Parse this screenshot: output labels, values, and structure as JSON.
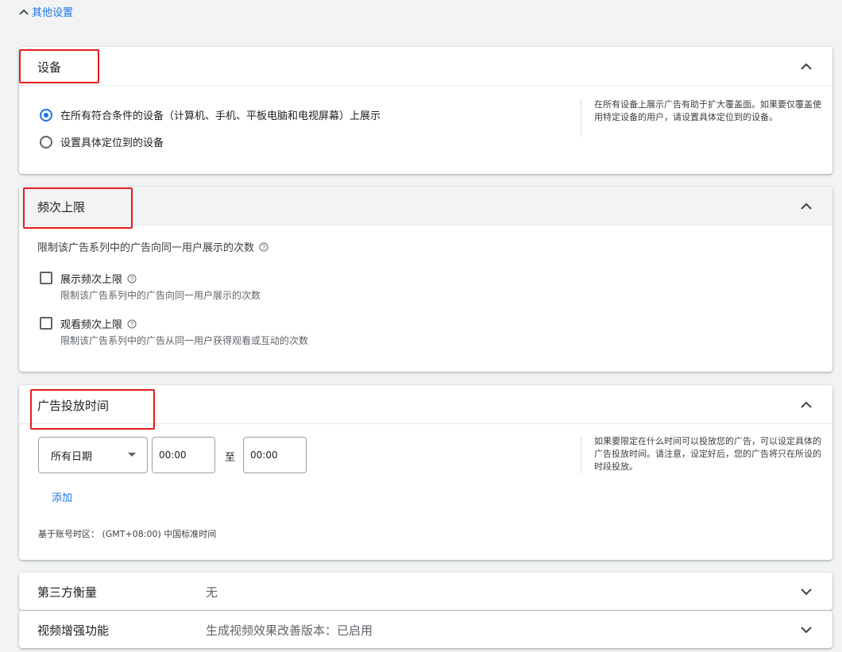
{
  "top_link": {
    "label": "其他设置"
  },
  "devices": {
    "title": "设备",
    "options": [
      {
        "label": "在所有符合条件的设备（计算机、手机、平板电脑和电视屏幕）上展示",
        "selected": true
      },
      {
        "label": "设置具体定位到的设备",
        "selected": false
      }
    ],
    "help": "在所有设备上展示广告有助于扩大覆盖面。如果要仅覆盖使用特定设备的用户，请设置具体定位到的设备。"
  },
  "frequency": {
    "title": "频次上限",
    "description": "限制该广告系列中的广告向同一用户展示的次数",
    "options": [
      {
        "label": "展示频次上限",
        "sub": "限制该广告系列中的广告向同一用户展示的次数",
        "checked": false
      },
      {
        "label": "观看频次上限",
        "sub": "限制该广告系列中的广告从同一用户获得观看或互动的次数",
        "checked": false
      }
    ]
  },
  "schedule": {
    "title": "广告投放时间",
    "day_select": "所有日期",
    "start_time": "00:00",
    "to_label": "至",
    "end_time": "00:00",
    "add_label": "添加",
    "timezone": "基于账号时区：  (GMT+08:00) 中国标准时间",
    "help": "如果要限定在什么时间可以投放您的广告，可以设定具体的广告投放时间。请注意，设定好后，您的广告将只在所设的时段投放。"
  },
  "collapsed_sections": [
    {
      "label": "第三方衡量",
      "value": "无"
    },
    {
      "label": "视频增强功能",
      "value": "生成视频效果改善版本：已启用"
    }
  ],
  "colors": {
    "accent": "#1a73e8",
    "highlight_box": "#e51c1c"
  }
}
